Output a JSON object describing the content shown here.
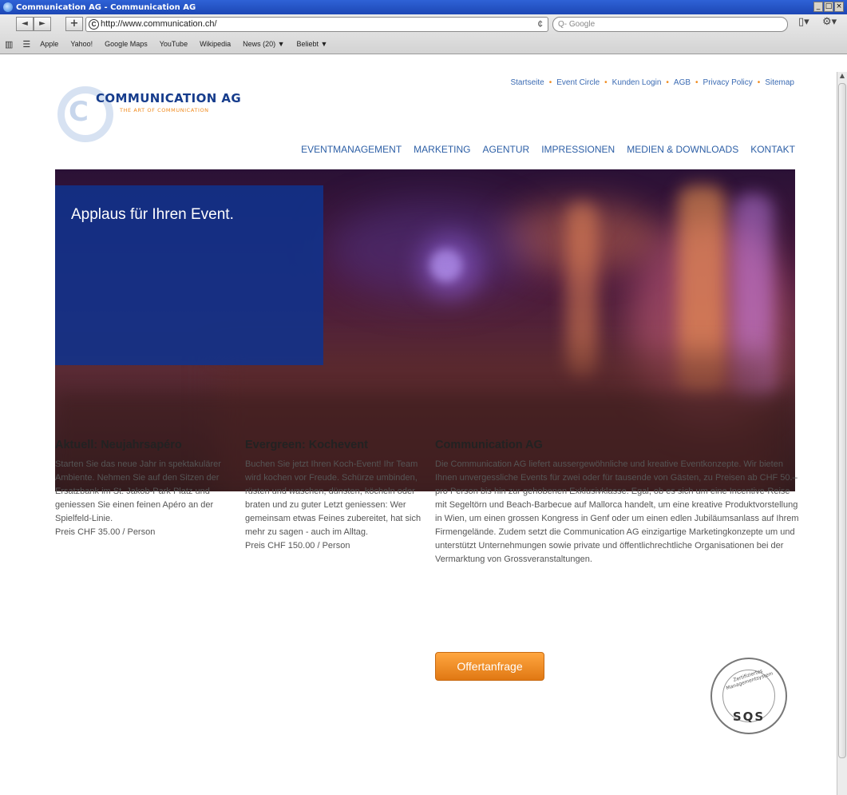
{
  "window": {
    "title": "Communication AG - Communication AG",
    "buttons": [
      "_",
      "□",
      "×"
    ]
  },
  "toolbar": {
    "back": "◄",
    "forward": "►",
    "add": "+",
    "url": "http://www.communication.ch/",
    "reload": "¢",
    "search_placeholder": "Q- Google",
    "page_menu": "▯▾",
    "gear_menu": "⚙▾"
  },
  "bookmarks": {
    "items": [
      "Apple",
      "Yahoo!",
      "Google Maps",
      "YouTube",
      "Wikipedia",
      "News (20) ▼",
      "Beliebt ▼"
    ]
  },
  "site": {
    "logo_name": "COMMUNICATION AG",
    "logo_tagline": "THE ART OF COMMUNICATION",
    "logo_letter": "C",
    "toplinks": [
      "Startseite",
      "Event Circle",
      "Kunden Login",
      "AGB",
      "Privacy Policy",
      "Sitemap"
    ],
    "toplink_separator": "•",
    "nav": [
      "EVENTMANAGEMENT",
      "MARKETING",
      "AGENTUR",
      "IMPRESSIONEN",
      "MEDIEN & DOWNLOADS",
      "KONTAKT"
    ],
    "hero_title": "Applaus für Ihren Event."
  },
  "columns": [
    {
      "title": "Aktuell: Neujahrsapéro",
      "text": "Starten Sie das neue Jahr in spektakulärer Ambiente. Nehmen Sie auf den Sitzen der Ersatzbank im St. Jakob-Park Platz und geniessen Sie einen feinen Apéro an der Spielfeld-Linie.",
      "price": "Preis CHF 35.00 / Person"
    },
    {
      "title": "Evergreen: Kochevent",
      "text": "Buchen Sie jetzt Ihren Koch-Event! Ihr Team wird kochen vor Freude. Schürze umbinden, rüsten und waschen, dünsten, köcheln oder braten und zu guter Letzt geniessen: Wer gemeinsam etwas Feines zubereitet, hat sich mehr zu sagen - auch im Alltag.",
      "price": "Preis CHF 150.00 / Person"
    },
    {
      "title": "Communication AG",
      "text": "Die Communication AG liefert aussergewöhnliche und kreative Eventkonzepte. Wir bieten Ihnen unvergessliche Events für zwei oder für tausende von Gästen, zu Preisen ab CHF 50.– pro Person bis hin zur gehobenen Exklusivklasse. Egal, ob es sich um eine Incentive-Reise mit Segeltörn und Beach-Barbecue auf Mallorca handelt, um eine kreative Produktvorstellung in Wien, um einen grossen Kongress in Genf oder um einen edlen Jubiläumsanlass auf Ihrem Firmengelände. Zudem setzt die Communication AG einzigartige Marketingkonzepte um und unterstützt Unternehmungen sowie private und öffentlichrechtliche Organisationen bei der Vermarktung von Grossveranstaltungen."
    }
  ],
  "offer_button": "Offertanfrage",
  "sqs": {
    "arc": "Zertifiziertes Managementsystem",
    "label": "SQS"
  }
}
